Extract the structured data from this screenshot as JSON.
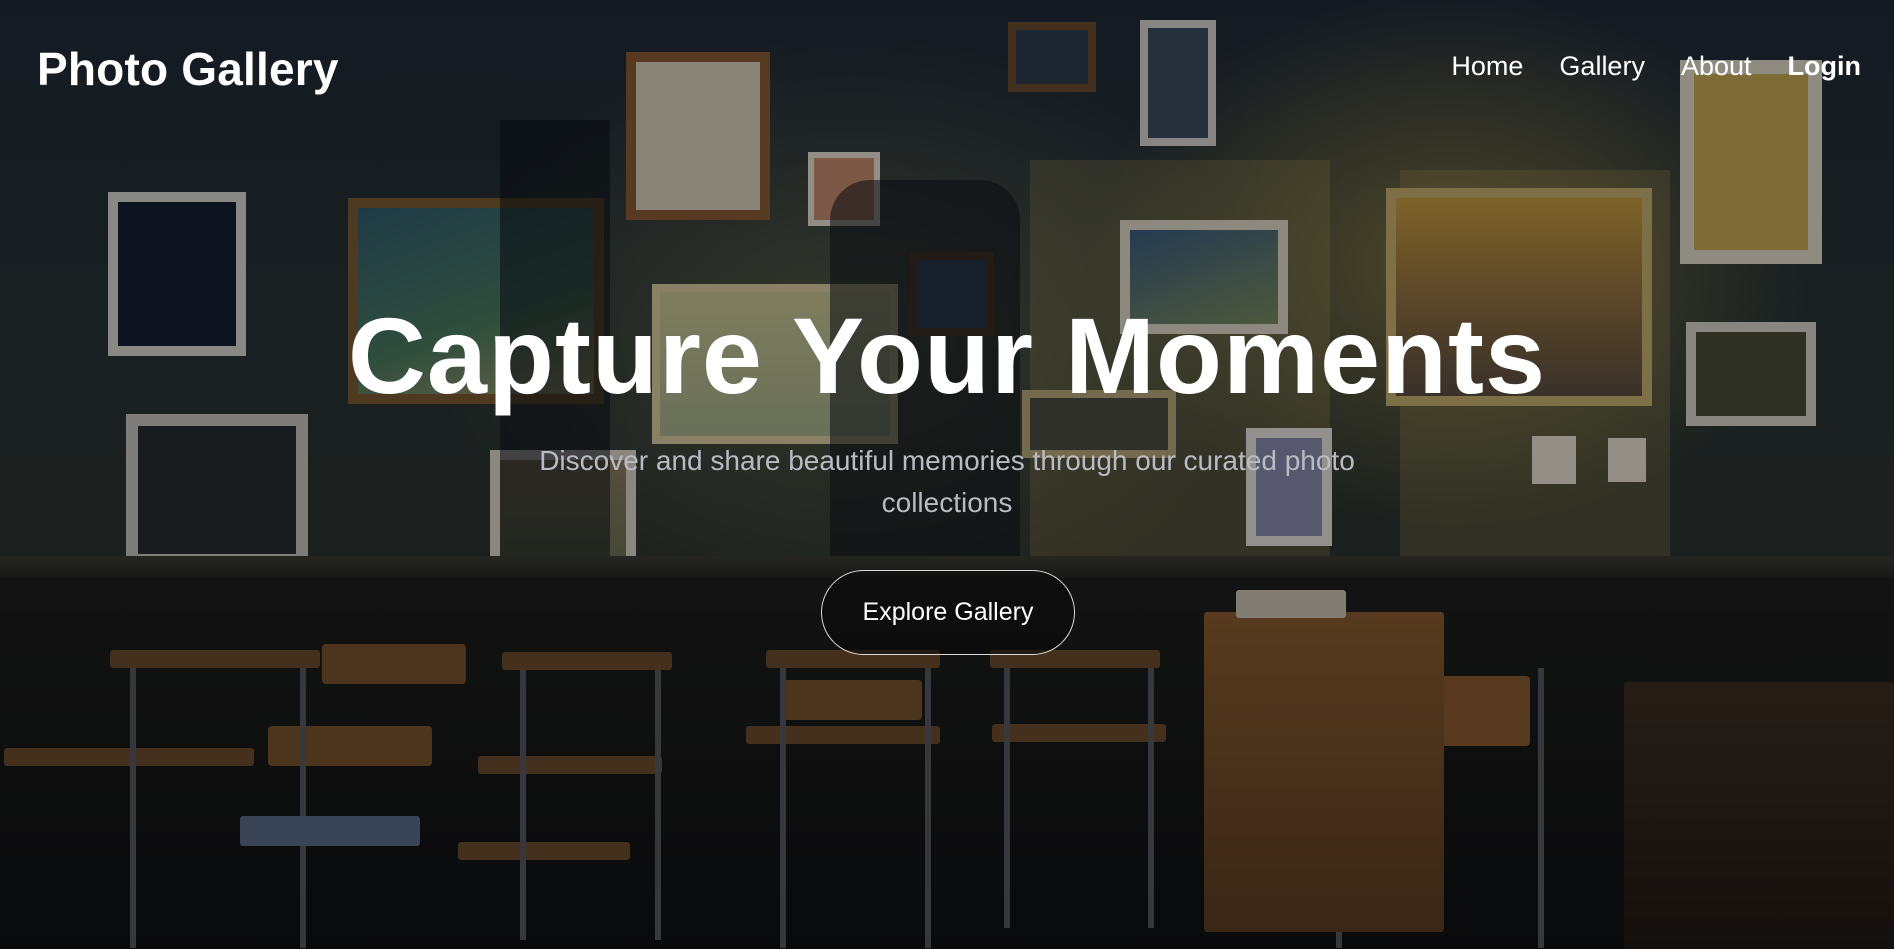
{
  "header": {
    "brand": "Photo Gallery",
    "nav": [
      {
        "label": "Home"
      },
      {
        "label": "Gallery"
      },
      {
        "label": "About"
      },
      {
        "label": "Login"
      }
    ]
  },
  "hero": {
    "headline": "Capture Your Moments",
    "subtitle": "Discover and share beautiful memories through our curated photo collections",
    "cta_label": "Explore Gallery"
  },
  "colors": {
    "text": "#ffffff",
    "subtitle": "#b8bcc2",
    "overlay": "#06080c",
    "warm_light": "#c8af5a"
  }
}
